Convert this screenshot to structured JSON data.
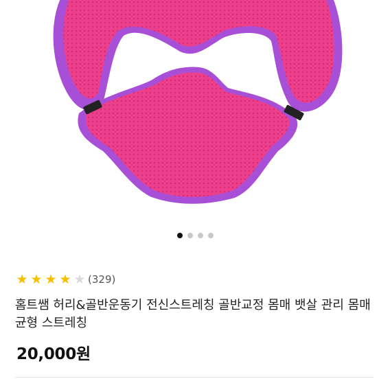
{
  "product": {
    "image_alt": "pink mesh hip and waist stretching cushion with purple trim",
    "colors": {
      "mesh": "#ec3f8c",
      "trim": "#a84fd8",
      "strap": "#222222"
    },
    "carousel": {
      "total": 4,
      "active_index": 0
    },
    "rating": {
      "value": 4,
      "max": 5,
      "count_text": "(329)",
      "star_color": "#f5c000"
    },
    "title": "홈트쌤 허리&골반운동기 전신스트레칭 골반교정 몸매 뱃살 관리 몸매균형 스트레칭",
    "price": "20,000원"
  }
}
